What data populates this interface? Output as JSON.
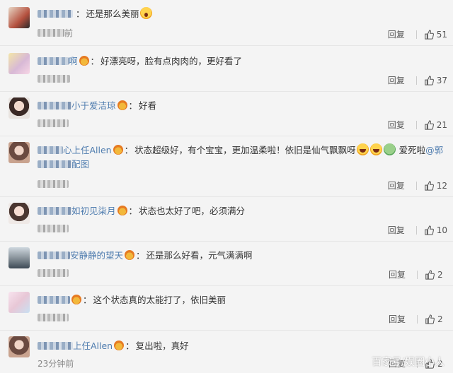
{
  "comments": [
    {
      "prefix": "",
      "name": "",
      "crown": false,
      "text": "还是那么美丽",
      "emoji": [
        "shock"
      ],
      "line2": "",
      "time": "前",
      "reply": "回复",
      "likes": "51"
    },
    {
      "prefix": "",
      "name": "啊",
      "crown": true,
      "text": "好漂亮呀，脸有点肉肉的，更好看了",
      "emoji": [],
      "line2": "",
      "time": "",
      "reply": "回复",
      "likes": "37"
    },
    {
      "prefix": "",
      "name": "小于爱洁琼",
      "crown": true,
      "text": "好看",
      "emoji": [],
      "line2": "",
      "time": "",
      "reply": "回复",
      "likes": "21"
    },
    {
      "prefix": "",
      "name": "心上任Allen",
      "crown": true,
      "text": "状态超级好，有个宝宝，更加温柔啦！依旧是仙气飘飘呀",
      "emoji": [
        "laugh",
        "laugh",
        "green"
      ],
      "text_tail": "爱死啦",
      "mention": "@郭",
      "line2": "配图",
      "time": "",
      "reply": "回复",
      "likes": "12"
    },
    {
      "prefix": "",
      "name": "如初见柒月",
      "crown": true,
      "text": "状态也太好了吧，必须满分",
      "emoji": [],
      "line2": "",
      "time": "",
      "reply": "回复",
      "likes": "10"
    },
    {
      "prefix": "",
      "name": "安静静的望天",
      "crown": true,
      "text": "还是那么好看，元气满满啊",
      "emoji": [],
      "line2": "",
      "time": "",
      "reply": "回复",
      "likes": "2"
    },
    {
      "prefix": "",
      "name": "",
      "crown": true,
      "text": "这个状态真的太能打了，依旧美丽",
      "emoji": [],
      "line2": "",
      "time": "",
      "reply": "回复",
      "likes": "2"
    },
    {
      "prefix": "",
      "name": "上任Allen",
      "crown": true,
      "text": "复出啦，真好",
      "emoji": [],
      "line2": "",
      "time": "23分钟前",
      "reply": "回复",
      "likes": "2"
    }
  ],
  "watermark": "百家号/娱圈小人",
  "colors": {
    "link": "#507daf",
    "background": "#f4f4f4",
    "divider": "#e6e6e6"
  }
}
